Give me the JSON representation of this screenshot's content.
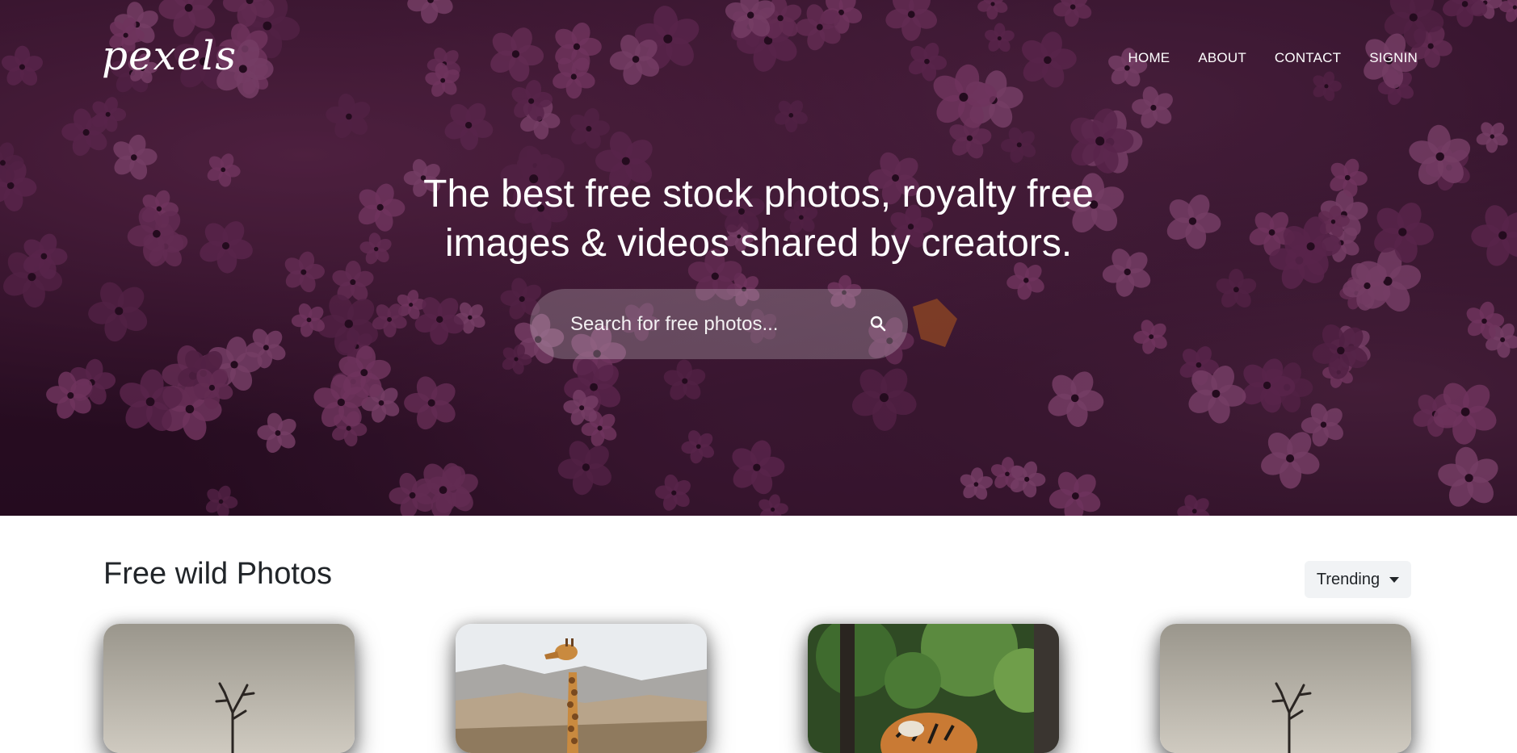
{
  "header": {
    "logo": "pexels",
    "nav": [
      "HOME",
      "ABOUT",
      "CONTACT",
      "SIGNIN"
    ]
  },
  "hero": {
    "headline_line1": "The best free stock photos, royalty free",
    "headline_line2": "images & videos shared by creators.",
    "search_placeholder": "Search for free photos..."
  },
  "section": {
    "title": "Free wild Photos",
    "sort_selected": "Trending"
  },
  "cards": [
    {
      "subject": "bare tree on pale wall"
    },
    {
      "subject": "giraffe in savanna"
    },
    {
      "subject": "tiger in forest"
    },
    {
      "subject": "bare tree on pale wall"
    }
  ],
  "colors": {
    "hero_tint": "#3a1630",
    "flower_pink": "#a14f86",
    "text_dark": "#212529",
    "dropdown_bg": "#f1f3f5"
  },
  "icons": {
    "search": "search-icon",
    "dropdown": "caret-down-icon"
  }
}
